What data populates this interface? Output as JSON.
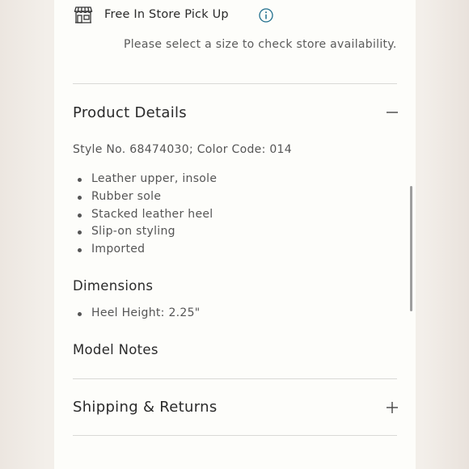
{
  "pickup": {
    "title": "Free In Store Pick Up",
    "subtitle": "Please select a size to check store availability.",
    "store_icon": "store-icon",
    "info_icon": "info-icon",
    "info_color": "#1f6e8c"
  },
  "product_details": {
    "title": "Product Details",
    "toggle_icon": "minus-icon",
    "style_line": "Style No. 68474030; Color Code: 014",
    "features": [
      "Leather upper, insole",
      "Rubber sole",
      "Stacked leather heel",
      "Slip-on styling",
      "Imported"
    ],
    "dimensions_title": "Dimensions",
    "dimensions": [
      "Heel Height: 2.25\""
    ],
    "model_notes_title": "Model Notes"
  },
  "shipping": {
    "title": "Shipping & Returns",
    "toggle_icon": "plus-icon"
  }
}
